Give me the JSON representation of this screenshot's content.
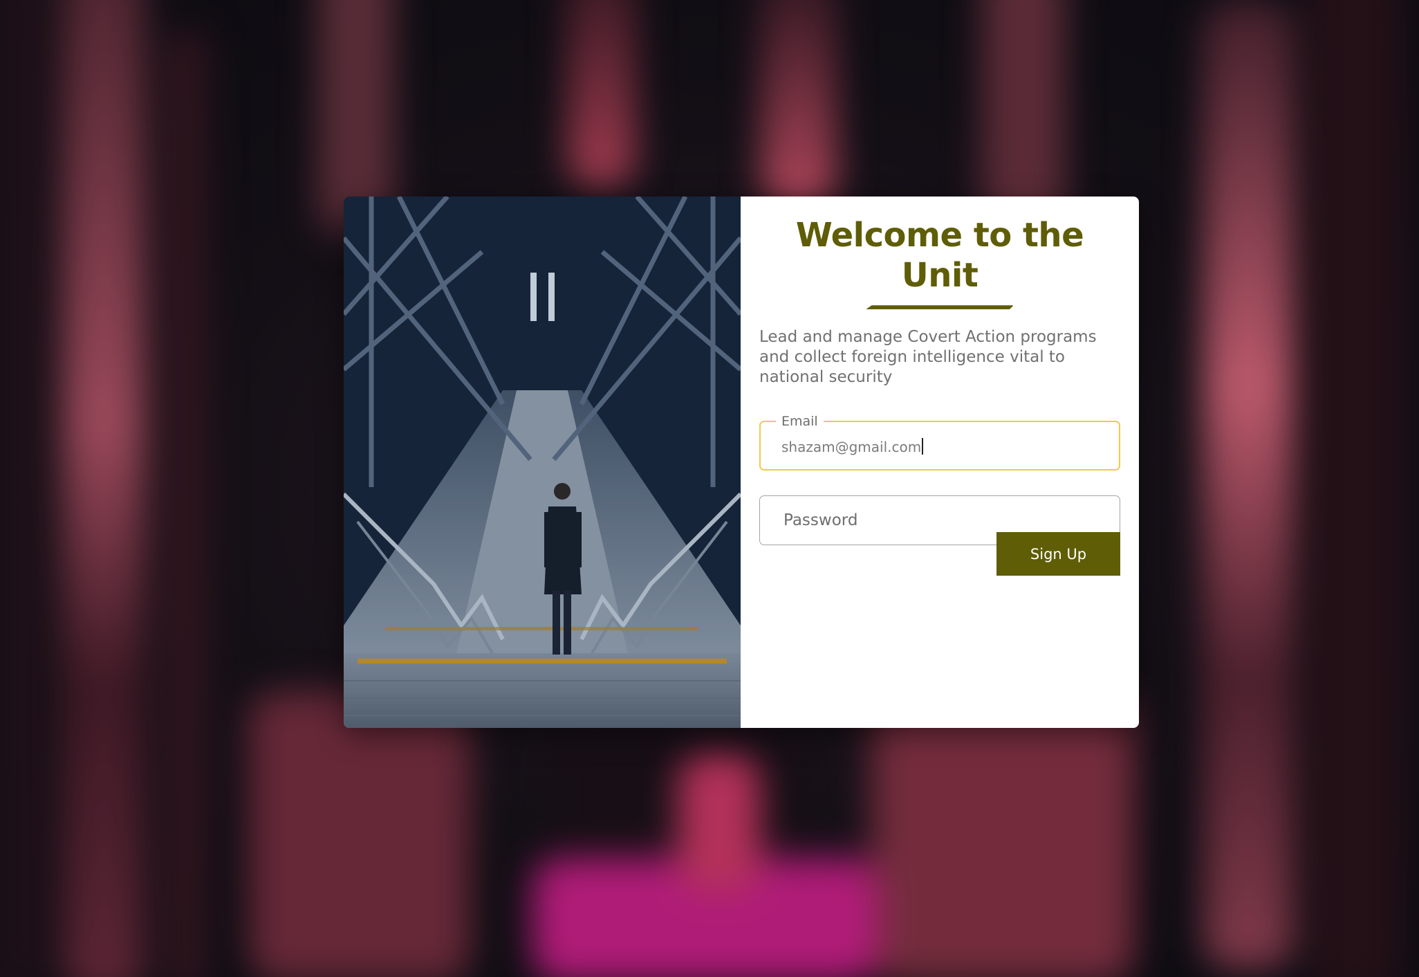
{
  "header": {
    "title": "Welcome to the Unit",
    "subtitle": "Lead and manage Covert Action programs and collect foreign intelligence vital to national security"
  },
  "form": {
    "email": {
      "label": "Email",
      "value": "shazam@gmail.com",
      "focused": true
    },
    "password": {
      "placeholder": "Password",
      "value": ""
    },
    "submit_label": "Sign Up"
  },
  "colors": {
    "accent": "#5f5d06",
    "focus_border": "#f2c94c",
    "text_muted": "#707070",
    "card_bg": "#ffffff"
  },
  "images": {
    "background": "blurred-neon-escalator-photo",
    "side_photo": "man-descending-escalator-photo"
  }
}
